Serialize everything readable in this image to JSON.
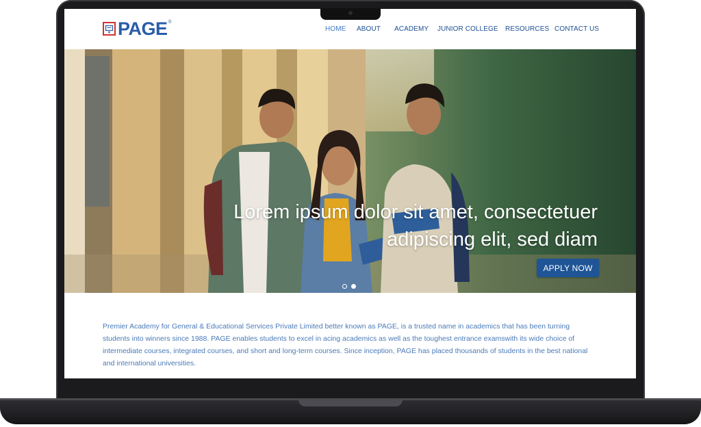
{
  "brand": {
    "name": "PAGE",
    "registered": "®"
  },
  "nav": {
    "items": [
      {
        "label": "HOME",
        "active": true
      },
      {
        "label": "ABOUT"
      },
      {
        "label": "ACADEMY"
      },
      {
        "label": "JUNIOR COLLEGE"
      },
      {
        "label": "RESOURCES"
      },
      {
        "label": "CONTACT US"
      }
    ]
  },
  "hero": {
    "headline": "Lorem ipsum dolor sit amet, consectetuer adipiscing elit, sed diam",
    "cta_label": "APPLY NOW",
    "slides_count": 2,
    "active_slide": 2
  },
  "about": {
    "text": "Premier Academy for General & Educational Services Private Limited better known as PAGE, is a trusted name in academics that has been turning students into winners since 1988. PAGE enables students to excel in acing academics as well as the toughest entrance examswith its wide choice of intermediate courses, integrated courses, and short and long-term courses. Since inception, PAGE has placed thousands of students in the best national and international universities."
  },
  "colors": {
    "brand_blue": "#2b5da8",
    "brand_red": "#d0302c",
    "nav_text": "#1c4f94",
    "button_bg": "#1f5596",
    "body_text": "#4a7ab8"
  },
  "icons": {
    "logo_mark": "classroom-board-icon"
  }
}
